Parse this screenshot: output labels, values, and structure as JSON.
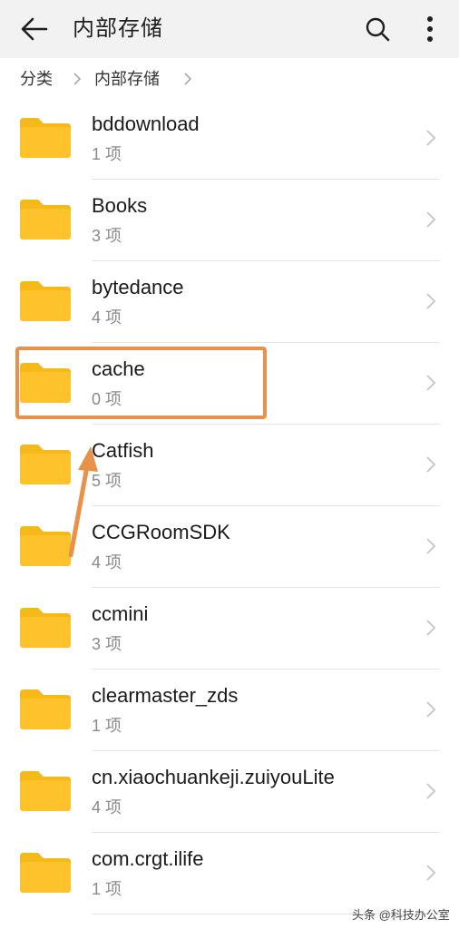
{
  "header": {
    "title": "内部存储",
    "back_icon": "arrow-left-icon",
    "search_icon": "search-icon",
    "more_icon": "more-vertical-icon"
  },
  "breadcrumb": {
    "items": [
      "分类",
      "内部存储"
    ]
  },
  "colors": {
    "folder": "#fdc22c",
    "folder_tab": "#f7b81a",
    "highlight": "#e8914a",
    "topbar": "#f2f2f2"
  },
  "files": [
    {
      "name": "bddownload",
      "count": "1 项"
    },
    {
      "name": "Books",
      "count": "3 项"
    },
    {
      "name": "bytedance",
      "count": "4 项"
    },
    {
      "name": "cache",
      "count": "0 项"
    },
    {
      "name": "Catfish",
      "count": "5 项"
    },
    {
      "name": "CCGRoomSDK",
      "count": "4 项"
    },
    {
      "name": "ccmini",
      "count": "3 项"
    },
    {
      "name": "clearmaster_zds",
      "count": "1 项"
    },
    {
      "name": "cn.xiaochuankeji.zuiyouLite",
      "count": "4 项"
    },
    {
      "name": "com.crgt.ilife",
      "count": "1 项"
    }
  ],
  "watermark": "头条 @科技办公室"
}
